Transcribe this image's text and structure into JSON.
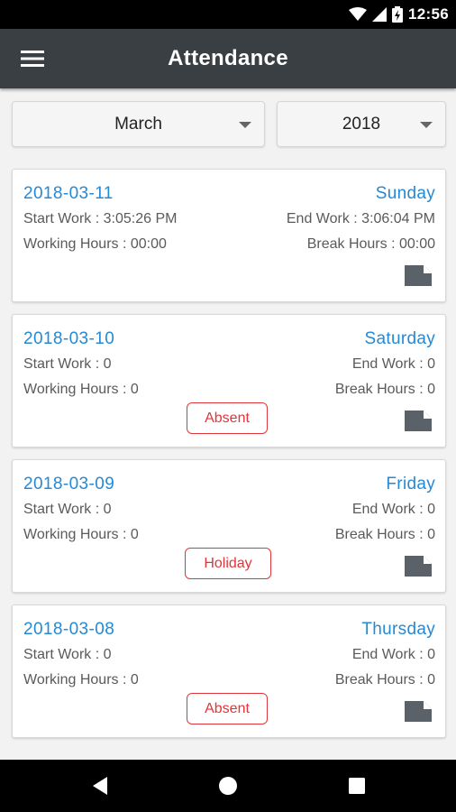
{
  "status_bar": {
    "time": "12:56"
  },
  "app_bar": {
    "title": "Attendance"
  },
  "filters": {
    "month": "March",
    "year": "2018"
  },
  "records": [
    {
      "date": "2018-03-11",
      "day": "Sunday",
      "start": "Start Work : 3:05:26 PM",
      "end": "End Work : 3:06:04 PM",
      "working": "Working Hours : 00:00",
      "break": "Break Hours : 00:00"
    },
    {
      "date": "2018-03-10",
      "day": "Saturday",
      "start": "Start Work : 0",
      "end": "End Work : 0",
      "working": "Working Hours : 0",
      "break": "Break Hours : 0",
      "status": "Absent"
    },
    {
      "date": "2018-03-09",
      "day": "Friday",
      "start": "Start Work : 0",
      "end": "End Work : 0",
      "working": "Working Hours : 0",
      "break": "Break Hours : 0",
      "status": "Holiday"
    },
    {
      "date": "2018-03-08",
      "day": "Thursday",
      "start": "Start Work : 0",
      "end": "End Work : 0",
      "working": "Working Hours : 0",
      "break": "Break Hours : 0",
      "status": "Absent"
    }
  ],
  "colors": {
    "accent": "#2489d6",
    "app_bar": "#3a3f44",
    "status_red": "#e0353a"
  },
  "icons": {
    "menu": "hamburger-menu-icon",
    "note": "note-icon",
    "back": "back-triangle-icon",
    "home": "home-circle-icon",
    "recents": "recents-square-icon"
  }
}
